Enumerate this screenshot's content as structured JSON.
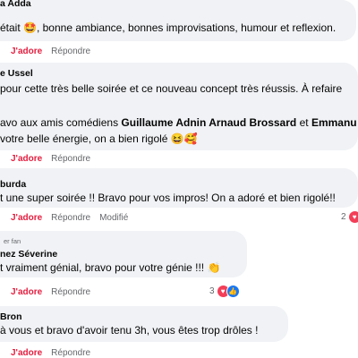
{
  "comments": [
    {
      "author": "a Adda",
      "lines": [
        "était 🤩, bonne ambiance, bonnes improvisations, humour et reflexion."
      ],
      "like_label": "J'adore",
      "reply_label": "Répondre"
    },
    {
      "author": "e Ussel",
      "lines": [
        "pour cette très belle soirée et ce nouveau concept très réussis. À refaire",
        "avo aux amis comédiens",
        "votre belle énergie, on a bien rigolé 😆🥰"
      ],
      "bold_names": "Guillaume Adnin Arnaud Brossard",
      "connector": "et",
      "bold_tail": "Emmanu",
      "like_label": "J'adore",
      "reply_label": "Répondre"
    },
    {
      "author": "burda",
      "lines": [
        "t une super soirée !! Bravo pour vos impros! On a adoré et bien rigolé!!"
      ],
      "like_label": "J'adore",
      "reply_label": "Répondre",
      "modified_label": "Modifié",
      "reaction_count": "2"
    },
    {
      "tag": "er fan",
      "author": "nez Séverine",
      "lines": [
        "t vraiment génial, bravo pour votre génie !!! 👏"
      ],
      "like_label": "J'adore",
      "reply_label": "Répondre",
      "reaction_count": "3"
    },
    {
      "author": "Bron",
      "lines": [
        "à vous et bravo d'avoir tenu 3h, vous êtes trop drôles !"
      ],
      "like_label": "J'adore",
      "reply_label": "Répondre"
    }
  ],
  "colors": {
    "bubble": "#f0f2f5",
    "love": "#e41e3f",
    "heart": "#f33e58",
    "like": "#1877f2"
  },
  "icons": [
    "heart-icon",
    "like-icon"
  ]
}
